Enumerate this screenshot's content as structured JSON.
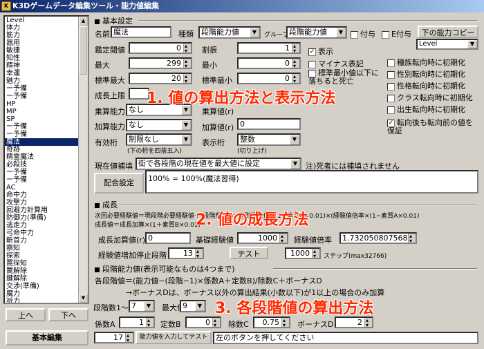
{
  "window": {
    "title": "K3Dゲームデータ編集ツール・能力値編集",
    "icon": "app-icon"
  },
  "list": {
    "items": [
      "Level",
      "体力",
      "筋力",
      "器用",
      "敏捷",
      "知性",
      "精神",
      "幸運",
      "魅力",
      "ー予備",
      "ー予備",
      "HP",
      "MP",
      "SP",
      "ー予備",
      "ー予備",
      "魔法",
      "奇跡",
      "精霊魔法",
      "必殺技",
      "ー予備",
      "ー予備",
      "AC",
      "命中力",
      "攻撃力",
      "回避力計算用",
      "防御力(準備)",
      "逃走力",
      "弓命中力",
      "斬首力",
      "察知",
      "探索",
      "罠探知",
      "罠解除",
      "鍵解除",
      "交渉(準備)",
      "魔力",
      "祈力"
    ],
    "selected_index": 16
  },
  "nav": {
    "up": "上へ",
    "down": "下へ",
    "basic_edit": "基本編集"
  },
  "basic": {
    "header": "基本設定",
    "name_label": "名前",
    "name_value": "魔法",
    "type_label": "種類",
    "type_value": "段階能力値",
    "group_label": "グループ",
    "group_value": "段階能力値",
    "grant_label": "付与",
    "e_grant_label": "E付与",
    "copy_button": "下の能力コピー",
    "copy_select": "Level",
    "appraisal_label": "鑑定閾値",
    "appraisal_value": "0",
    "split_label": "割振",
    "split_value": "1",
    "max_label": "最大",
    "max_value": "299",
    "min_label": "最小",
    "min_value": "0",
    "std_max_label": "標準最大",
    "std_max_value": "20",
    "std_min_label": "標準最小",
    "std_min_value": "0",
    "growth_limit_label": "成長上限",
    "mul_label": "乗算能力",
    "mul_value": "なし",
    "mul_val_label": "乗算値(r)",
    "add_label": "加算能力",
    "add_value": "なし",
    "add_val_label": "加算値(r)",
    "add_val_value": "0",
    "sig_label": "有効桁",
    "sig_value": "制限なし",
    "sig_note": "(下の桁を四捨五入)",
    "disp_label": "表示桁",
    "disp_value": "整数",
    "disp_note": "(切り上げ)",
    "show_label": "表示",
    "minus_label": "マイナス表記",
    "death_label": "標準最小値以下に落ちると死亡",
    "race_label": "種族転向時に初期化",
    "sex_label": "性別転向時に初期化",
    "char_label": "性格転向時に初期化",
    "class_label": "クラス転向時に初期化",
    "birth_label": "出生転向時に初期化",
    "keep_label": "転向後も転向前の値を保証",
    "correction_label": "現在値補填",
    "correction_value": "街で各段階の現在値を最大値に設定",
    "correction_note": "注)死者には補填されません",
    "formula_button": "配合設定",
    "formula_value": "100% = 100%(魔法習得)"
  },
  "growth": {
    "header": "成長",
    "line1": "次回必要経験値＝現段階必要経験値＋(段階数−1)×基礎経験値×(1＋素質A×0.01)×(経験値倍率×(1−素質A×0.01)",
    "line2": "成長値＝成長加算×(1＋素質B×0.01)",
    "add_label": "成長加算値(r)",
    "add_value": "0",
    "base_label": "基礎経験値",
    "base_value": "1000",
    "rate_label": "経験値倍率",
    "rate_value": "1.73205080756888",
    "stop_label": "経験値増加停止段階",
    "stop_value": "13",
    "test_button": "テスト",
    "test_value": "1000",
    "step_note": "ステップ(max32766)"
  },
  "stage": {
    "header": "段階能力値(表示可能なものは4つまで)",
    "formula": "各段階値＝(能力値−(段階−1)×係数A＋定数B)/除数C＋ボーナスD",
    "note": "→ボーナスDは、ボーナス以外の算出結果(小数以下)が1以上の場合のみ加算",
    "count_label": "段階数1〜",
    "count_value": "7",
    "max_label": "最大値",
    "max_value": "9",
    "coef_a_label": "係数A",
    "coef_a_value": "1",
    "const_b_label": "定数B",
    "const_b_value": "0",
    "div_c_label": "除数C",
    "div_c_value": "0.75",
    "bonus_d_label": "ボーナスD",
    "bonus_d_value": "2",
    "input_value": "17",
    "input_button": "能力値を入力してテスト",
    "hint": "左のボタンを押してください"
  },
  "overlays": {
    "o1": "1. 値の算出方法と表示方法",
    "o2": "2. 値の成長方法",
    "o3": "3. 各段階値の算出方法"
  },
  "colors": {
    "overlay": "#ff2a00",
    "titlebar": "#0a246a",
    "selection": "#0a246a"
  }
}
